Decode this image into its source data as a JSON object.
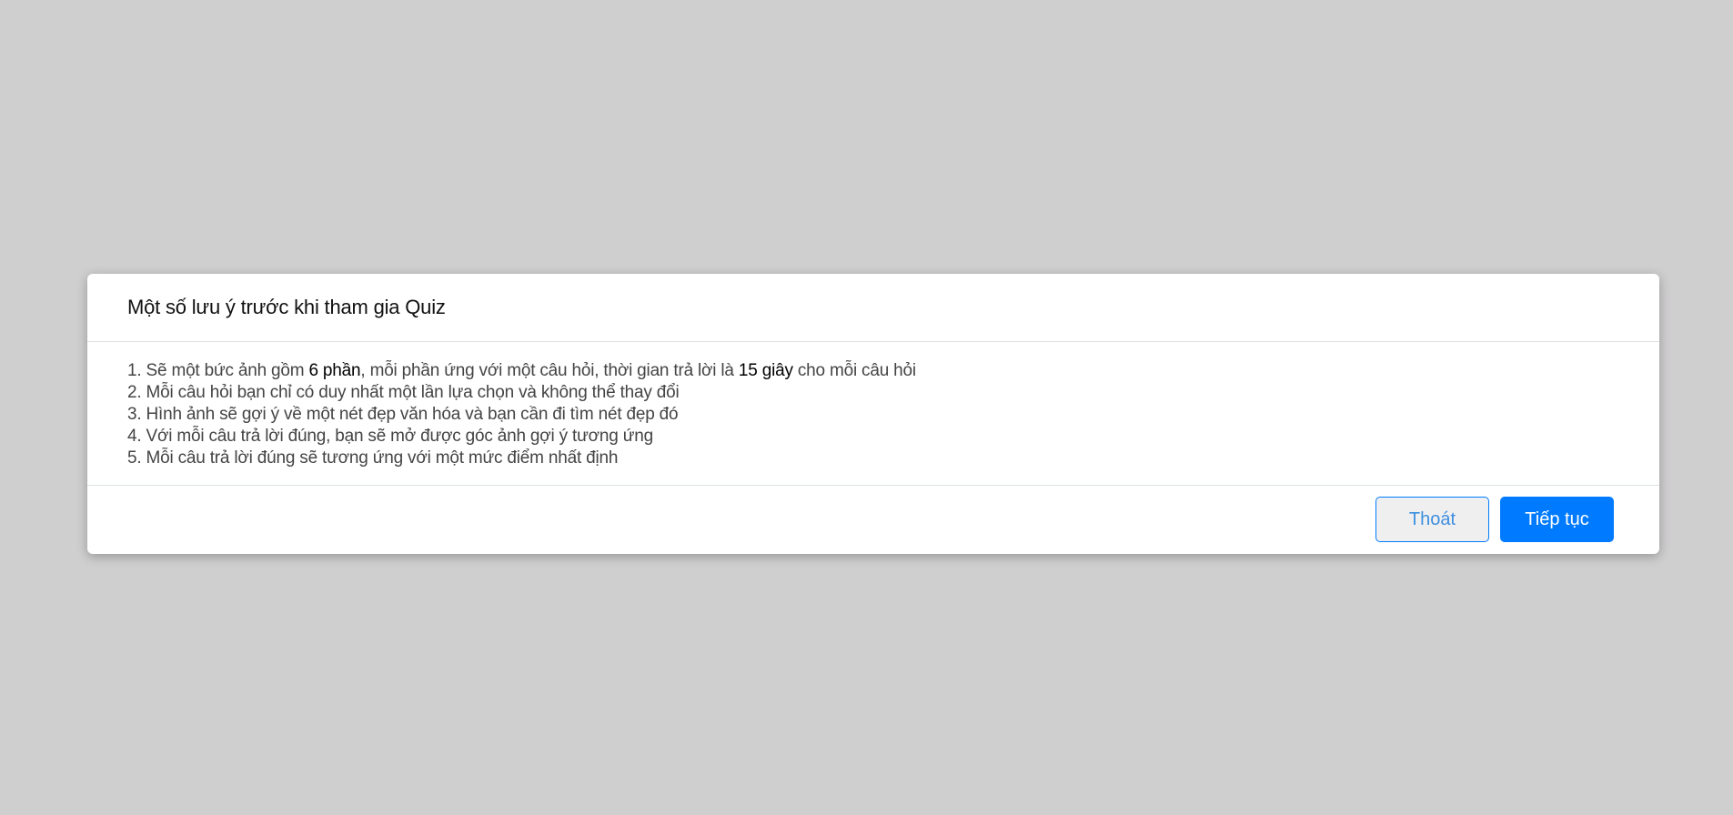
{
  "modal": {
    "title": "Một số lưu ý trước khi tham gia Quiz",
    "rules": [
      {
        "prefix": "1. Sẽ một bức ảnh gồm ",
        "bold1": "6 phần",
        "middle": ", mỗi phần ứng với một câu hỏi, thời gian trả lời là ",
        "bold2": "15 giây",
        "suffix": " cho mỗi câu hỏi"
      },
      {
        "text": "2. Mỗi câu hỏi bạn chỉ có duy nhất một lần lựa chọn và không thể thay đổi"
      },
      {
        "text": "3. Hình ảnh sẽ gợi ý về một nét đẹp văn hóa và bạn cần đi tìm nét đẹp đó"
      },
      {
        "text": "4. Với mỗi câu trả lời đúng, bạn sẽ mở được góc ảnh gợi ý tương ứng"
      },
      {
        "text": "5. Mỗi câu trả lời đúng sẽ tương ứng với một mức điểm nhất định"
      }
    ],
    "buttons": {
      "exit_label": "Thoát",
      "continue_label": "Tiếp tục"
    }
  },
  "colors": {
    "backdrop": "#d0cfd0",
    "primary": "#007bff"
  }
}
